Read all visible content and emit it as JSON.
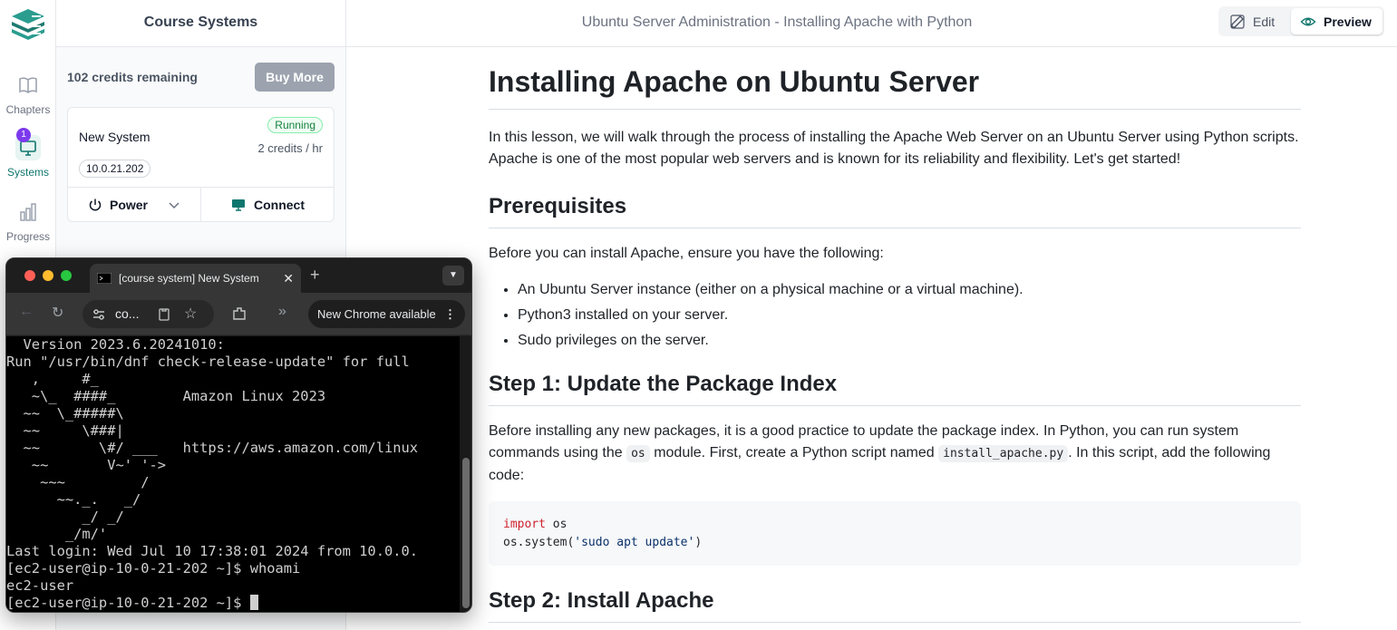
{
  "rail": {
    "items": [
      {
        "label": "Chapters"
      },
      {
        "label": "Systems",
        "badge": "1"
      },
      {
        "label": "Progress"
      }
    ]
  },
  "sidebar": {
    "title": "Course Systems",
    "credits": "102 credits remaining",
    "buy_label": "Buy More",
    "system": {
      "name": "New System",
      "status": "Running",
      "rate": "2 credits / hr",
      "ip": "10.0.21.202",
      "power_label": "Power",
      "connect_label": "Connect"
    }
  },
  "header": {
    "title": "Ubuntu Server Administration - Installing Apache with Python",
    "edit_label": "Edit",
    "preview_label": "Preview"
  },
  "doc": {
    "h1": "Installing Apache on Ubuntu Server",
    "intro": "In this lesson, we will walk through the process of installing the Apache Web Server on an Ubuntu Server using Python scripts. Apache is one of the most popular web servers and is known for its reliability and flexibility. Let's get started!",
    "prereq_heading": "Prerequisites",
    "prereq_intro": "Before you can install Apache, ensure you have the following:",
    "prereq_items": [
      "An Ubuntu Server instance (either on a physical machine or a virtual machine).",
      "Python3 installed on your server.",
      "Sudo privileges on the server."
    ],
    "step1_heading": "Step 1: Update the Package Index",
    "step1_p1": "Before installing any new packages, it is a good practice to update the package index. In Python, you can run system commands using the",
    "step1_code1": "os",
    "step1_p2": "module. First, create a Python script named",
    "step1_code2": "install_apache.py",
    "step1_p3": ". In this script, add the following code:",
    "code_line1_kw": "import",
    "code_line1_rest": " os",
    "code_line2_a": "os.system(",
    "code_line2_str": "'sudo apt update'",
    "code_line2_b": ")",
    "step2_heading": "Step 2: Install Apache"
  },
  "browser": {
    "tab_title": "[course system] New System",
    "url": "co...",
    "new_chrome": "New Chrome available"
  },
  "terminal": {
    "lines": [
      "  Version 2023.6.20241010:",
      "Run \"/usr/bin/dnf check-release-update\" for full",
      "   ,     #_",
      "   ~\\_  ####_        Amazon Linux 2023",
      "  ~~  \\_#####\\",
      "  ~~     \\###|",
      "  ~~       \\#/ ___   https://aws.amazon.com/linux",
      "   ~~       V~' '->",
      "    ~~~         /",
      "      ~~._.   _/",
      "         _/ _/",
      "       _/m/'",
      "Last login: Wed Jul 10 17:38:01 2024 from 10.0.0.",
      "[ec2-user@ip-10-0-21-202 ~]$ whoami",
      "ec2-user"
    ],
    "prompt": "[ec2-user@ip-10-0-21-202 ~]$ "
  }
}
